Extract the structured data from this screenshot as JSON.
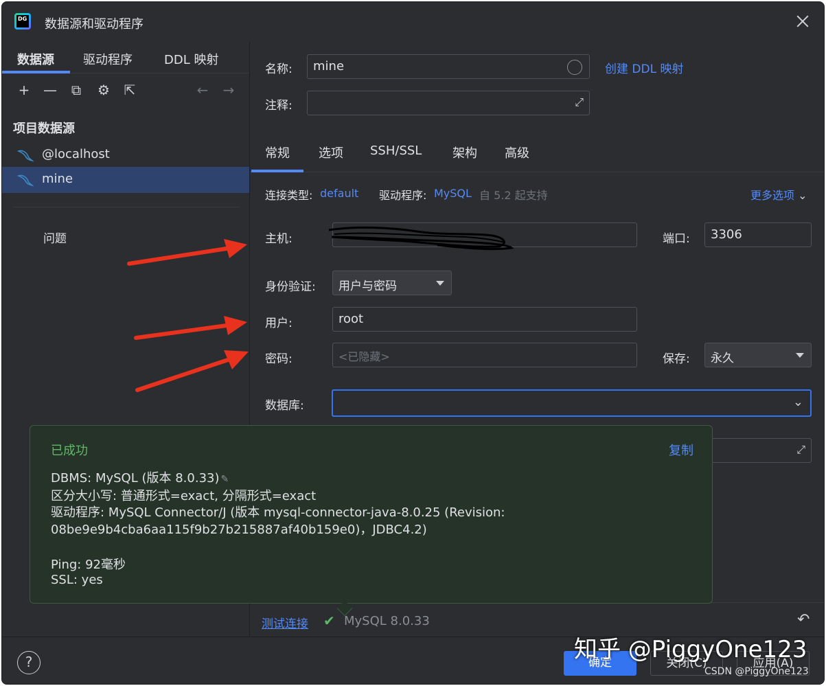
{
  "window": {
    "title": "数据源和驱动程序",
    "logo_text": "DG"
  },
  "left": {
    "tabs": [
      "数据源",
      "驱动程序",
      "DDL 映射"
    ],
    "toolbar": {
      "add": "+",
      "remove": "—",
      "copy": "⧉",
      "settings": "⚙",
      "export": "⇱",
      "back": "←",
      "forward": "→"
    },
    "section_title": "项目数据源",
    "items": [
      {
        "label": "@localhost"
      },
      {
        "label": "mine"
      }
    ],
    "problems": "问题"
  },
  "main": {
    "name_label": "名称:",
    "name_value": "mine",
    "ddl_link": "创建 DDL 映射",
    "comment_label": "注释:",
    "tabs": [
      "常规",
      "选项",
      "SSH/SSL",
      "架构",
      "高级"
    ],
    "conn_type_label": "连接类型:",
    "conn_type_value": "default",
    "driver_label": "驱动程序:",
    "driver_value": "MySQL",
    "driver_note": "自 5.2 起支持",
    "more_options": "更多选项",
    "host_label": "主机:",
    "port_label": "端口:",
    "port_value": "3306",
    "auth_label": "身份验证:",
    "auth_value": "用户与密码",
    "user_label": "用户:",
    "user_value": "root",
    "password_label": "密码:",
    "password_placeholder": "<已隐藏>",
    "save_label": "保存:",
    "save_value": "永久",
    "database_label": "数据库:"
  },
  "popup": {
    "status": "已成功",
    "copy": "复制",
    "lines": [
      "DBMS: MySQL (版本 8.0.33)",
      "区分大小写: 普通形式=exact, 分隔形式=exact",
      "驱动程序: MySQL Connector/J (版本 mysql-connector-java-8.0.25 (Revision:",
      "08be9e9b4cba6aa115f9b27b215887af40b159e0)，JDBC4.2)",
      "Ping: 92毫秒",
      "SSL: yes"
    ]
  },
  "bottom": {
    "test_link": "测试连接",
    "version": "MySQL 8.0.33"
  },
  "footer": {
    "help": "?",
    "ok": "确定",
    "close": "关闭(C)",
    "apply": "应用(A)"
  },
  "watermark": {
    "main": "知乎 @PiggyOne123",
    "sub": "CSDN @PiggyOne123"
  },
  "colors": {
    "accent": "#3574f0",
    "success": "#5fb865",
    "link": "#548af7",
    "arrow": "#e8321e"
  }
}
